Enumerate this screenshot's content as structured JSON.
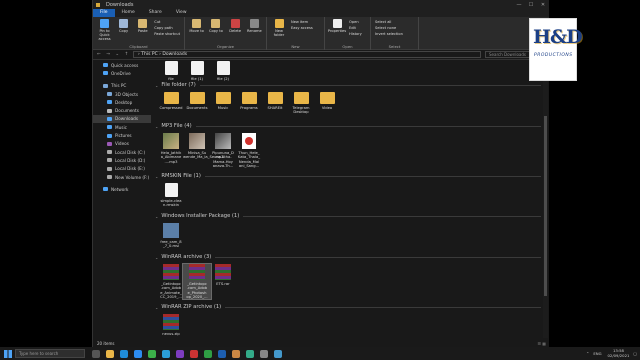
{
  "window": {
    "title": "Downloads",
    "controls": [
      "—",
      "☐",
      "✕"
    ]
  },
  "menu": {
    "tabs": [
      "File",
      "Home",
      "Share",
      "View"
    ]
  },
  "ribbon": {
    "clipboard": {
      "label": "Clipboard",
      "pin": "Pin to Quick access",
      "copy": "Copy",
      "paste": "Paste",
      "cut": "Cut",
      "copy_path": "Copy path",
      "paste_shortcut": "Paste shortcut"
    },
    "organize": {
      "label": "Organize",
      "move_to": "Move to",
      "copy_to": "Copy to",
      "delete": "Delete",
      "rename": "Rename"
    },
    "new": {
      "label": "New",
      "new_folder": "New folder",
      "new_item": "New item",
      "easy_access": "Easy access"
    },
    "open": {
      "label": "Open",
      "properties": "Properties",
      "open": "Open",
      "edit": "Edit",
      "history": "History"
    },
    "select": {
      "label": "Select",
      "select_all": "Select all",
      "select_none": "Select none",
      "invert": "Invert selection"
    }
  },
  "address": {
    "nav": "← → ⌄ ↑",
    "path": "› This PC › Downloads",
    "search_placeholder": "Search Downloads"
  },
  "sidebar": {
    "items": [
      {
        "label": "Quick access",
        "color": "#4ea3f5",
        "sub": false
      },
      {
        "label": "OneDrive",
        "color": "#4ea3f5",
        "sub": false
      },
      {
        "label": "This PC",
        "color": "#7aa7d8",
        "sub": false
      },
      {
        "label": "3D Objects",
        "color": "#7aa7d8",
        "sub": true
      },
      {
        "label": "Desktop",
        "color": "#4ea3f5",
        "sub": true
      },
      {
        "label": "Documents",
        "color": "#bbbbbb",
        "sub": true
      },
      {
        "label": "Downloads",
        "color": "#4ea3f5",
        "sub": true,
        "selected": true
      },
      {
        "label": "Music",
        "color": "#4ea3f5",
        "sub": true
      },
      {
        "label": "Pictures",
        "color": "#4ea3f5",
        "sub": true
      },
      {
        "label": "Videos",
        "color": "#9b59b6",
        "sub": true
      },
      {
        "label": "Local Disk (C:)",
        "color": "#aaaaaa",
        "sub": true
      },
      {
        "label": "Local Disk (D:)",
        "color": "#aaaaaa",
        "sub": true
      },
      {
        "label": "Local Disk (E:)",
        "color": "#aaaaaa",
        "sub": true
      },
      {
        "label": "New Volume (F:)",
        "color": "#aaaaaa",
        "sub": true
      },
      {
        "label": "Network",
        "color": "#4ea3f5",
        "sub": false
      }
    ]
  },
  "groups": {
    "top_files": [
      "file",
      "file (1)",
      "file (2)"
    ],
    "file_folder": {
      "header": "File folder (7)",
      "items": [
        "Compressed",
        "Documents",
        "Music",
        "Programs",
        "SHAREit",
        "Telegram Desktop",
        "Video"
      ]
    },
    "mp3": {
      "header": "MP3 File (4)",
      "items": [
        "Hela_Jathik a_Abimane ....mp3",
        "Minisa_Su wende_Ma_la_Se.mp3",
        "Pipununa_D ura-Atha-Mama-Hoy anava-Th...",
        "Thun_Hele_ Kata_Thala_ Nenda_Mal ani_Sang..."
      ]
    },
    "rmskin": {
      "header": "RMSKIN File (1)",
      "items": [
        "simple-clea n.rmskin"
      ]
    },
    "msi": {
      "header": "Windows Installer Package (1)",
      "items": [
        "free_cam_8 _7_0.msi"
      ]
    },
    "rar": {
      "header": "WinRAR archive (3)",
      "items": [
        "_Getintopc .com_Adob e_Animate_ CC_2019_...",
        "_Getintopc .com_Adob e_Photosh op_2020_...",
        "ETS.rar"
      ]
    },
    "zip": {
      "header": "WinRAR ZIP archive (1)",
      "items": [
        "nevus.zip"
      ]
    }
  },
  "status": {
    "count": "20 items",
    "views": "☰ ▦"
  },
  "taskbar": {
    "search_placeholder": "Type here to search",
    "tray": {
      "lang": "ENG",
      "time": "13:58",
      "date": "02/09/2021"
    }
  },
  "logo": {
    "text": "H&D",
    "subtitle": "PRODUCTIONS"
  }
}
